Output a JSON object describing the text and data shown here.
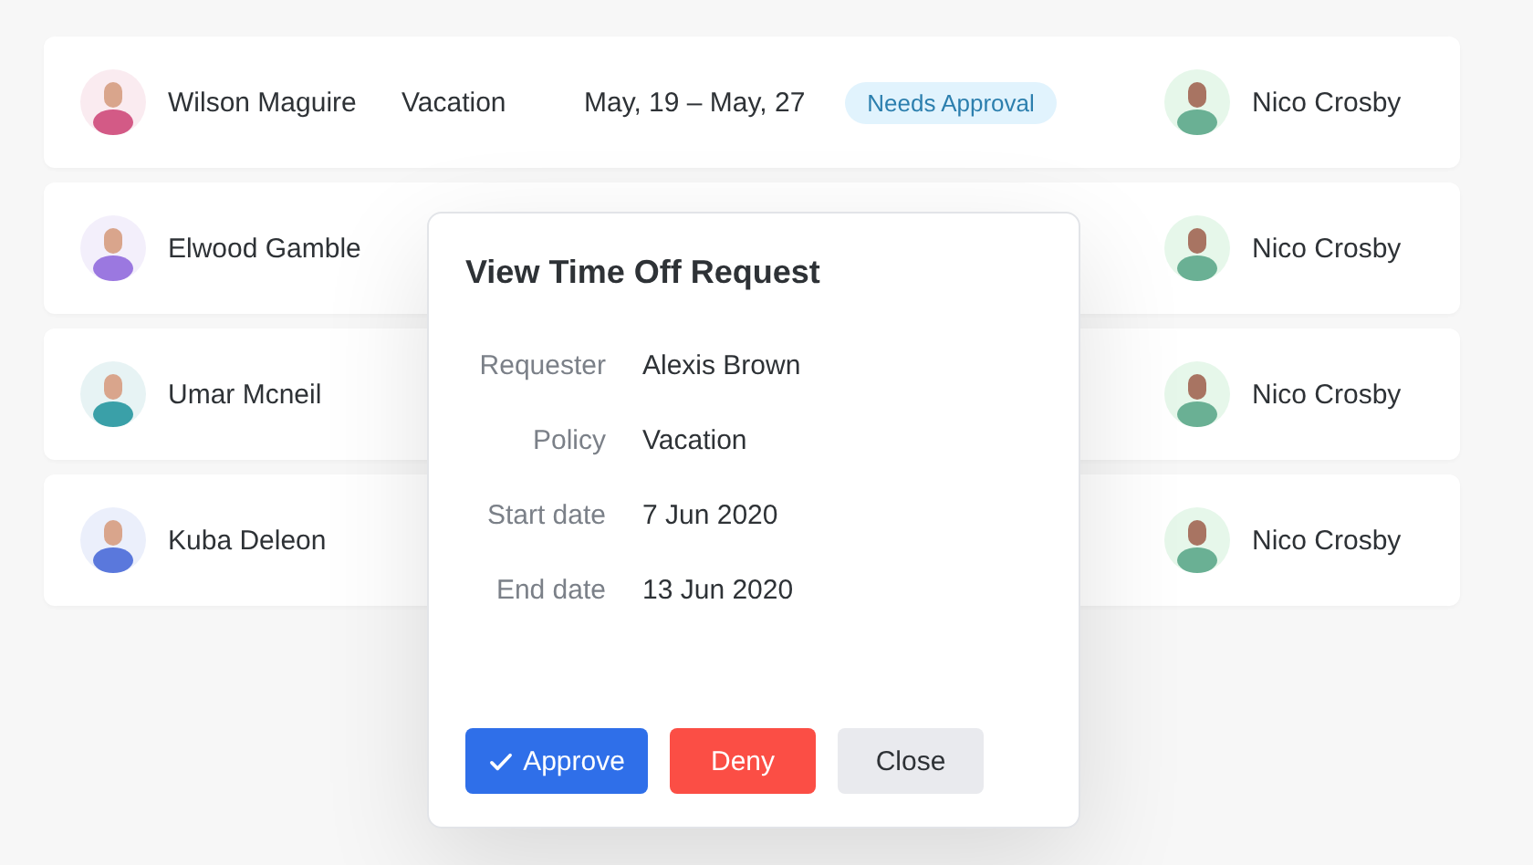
{
  "rows": [
    {
      "requester": "Wilson Maguire",
      "color": "#d35a86",
      "policy": "Vacation",
      "dates": "May, 19 – May, 27",
      "status": "Needs Approval",
      "approver": "Nico Crosby"
    },
    {
      "requester": "Elwood Gamble",
      "color": "#9b78e0",
      "approver": "Nico Crosby"
    },
    {
      "requester": "Umar Mcneil",
      "color": "#3aa0a8",
      "approver": "Nico Crosby"
    },
    {
      "requester": "Kuba Deleon",
      "color": "#5a78dc",
      "approver": "Nico Crosby"
    }
  ],
  "dialog": {
    "title": "View Time Off Request",
    "fields": [
      {
        "label": "Requester",
        "value": "Alexis Brown"
      },
      {
        "label": "Policy",
        "value": "Vacation"
      },
      {
        "label": "Start date",
        "value": "7 Jun 2020"
      },
      {
        "label": "End date",
        "value": "13 Jun 2020"
      }
    ],
    "buttons": [
      {
        "kind": "approve",
        "label": "Approve"
      },
      {
        "kind": "deny",
        "label": "Deny"
      },
      {
        "kind": "close",
        "label": "Close"
      }
    ]
  }
}
